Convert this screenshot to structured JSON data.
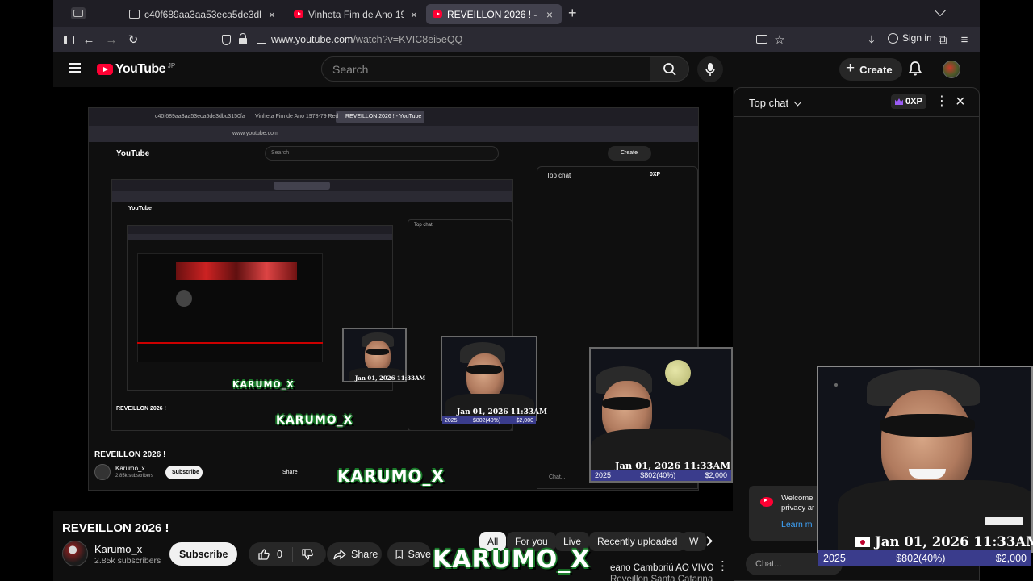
{
  "tabs": [
    {
      "label": "c40f689aa3aa53eca5de3dbc3150fa",
      "active": false
    },
    {
      "label": "Vinheta Fim de Ano 1978-79 Red",
      "active": false
    },
    {
      "label": "REVEILLON 2026 ! - YouTube",
      "active": true
    }
  ],
  "toolbar": {
    "url_domain": "www.youtube.com",
    "url_path": "/watch?v=KVIC8ei5eQQ",
    "signin_label": "Sign in"
  },
  "youtube": {
    "logo_text": "YouTube",
    "region": "JP",
    "search_placeholder": "Search",
    "create_label": "Create"
  },
  "video": {
    "overlay_date": "Jan 01, 2026 11:33AM",
    "overlay_year": "2025",
    "overlay_progress": "$802(40%)",
    "overlay_goal": "$2,000",
    "overlay_brand": "KARUMO_X",
    "nested_title": "REVEILLON 2026 !",
    "nested_channel": "Karumo_x",
    "nested_subs": "2.85k subscribers"
  },
  "below": {
    "title": "REVEILLON 2026 !",
    "channel": "Karumo_x",
    "subscribers": "2.85k subscribers",
    "subscribe_label": "Subscribe",
    "likes": "0",
    "share_label": "Share",
    "save_label": "Save",
    "chips": [
      "All",
      "For you",
      "Live",
      "Recently uploaded",
      "W"
    ],
    "rec_line1": "eano Camboriú AO VIVO",
    "rec_line2": "Reveillon Santa  Catarina"
  },
  "chat": {
    "title": "Top chat",
    "xp": "0XP",
    "welcome_line1": "Welcome",
    "welcome_line2": "privacy ar",
    "learn_more": "Learn m",
    "input_placeholder": "Chat..."
  },
  "colors": {
    "brand_red": "#ff0033",
    "link_blue": "#3ea6ff",
    "stat_bar": "#3a3c8c",
    "crown_purple": "#9b5cf5"
  }
}
